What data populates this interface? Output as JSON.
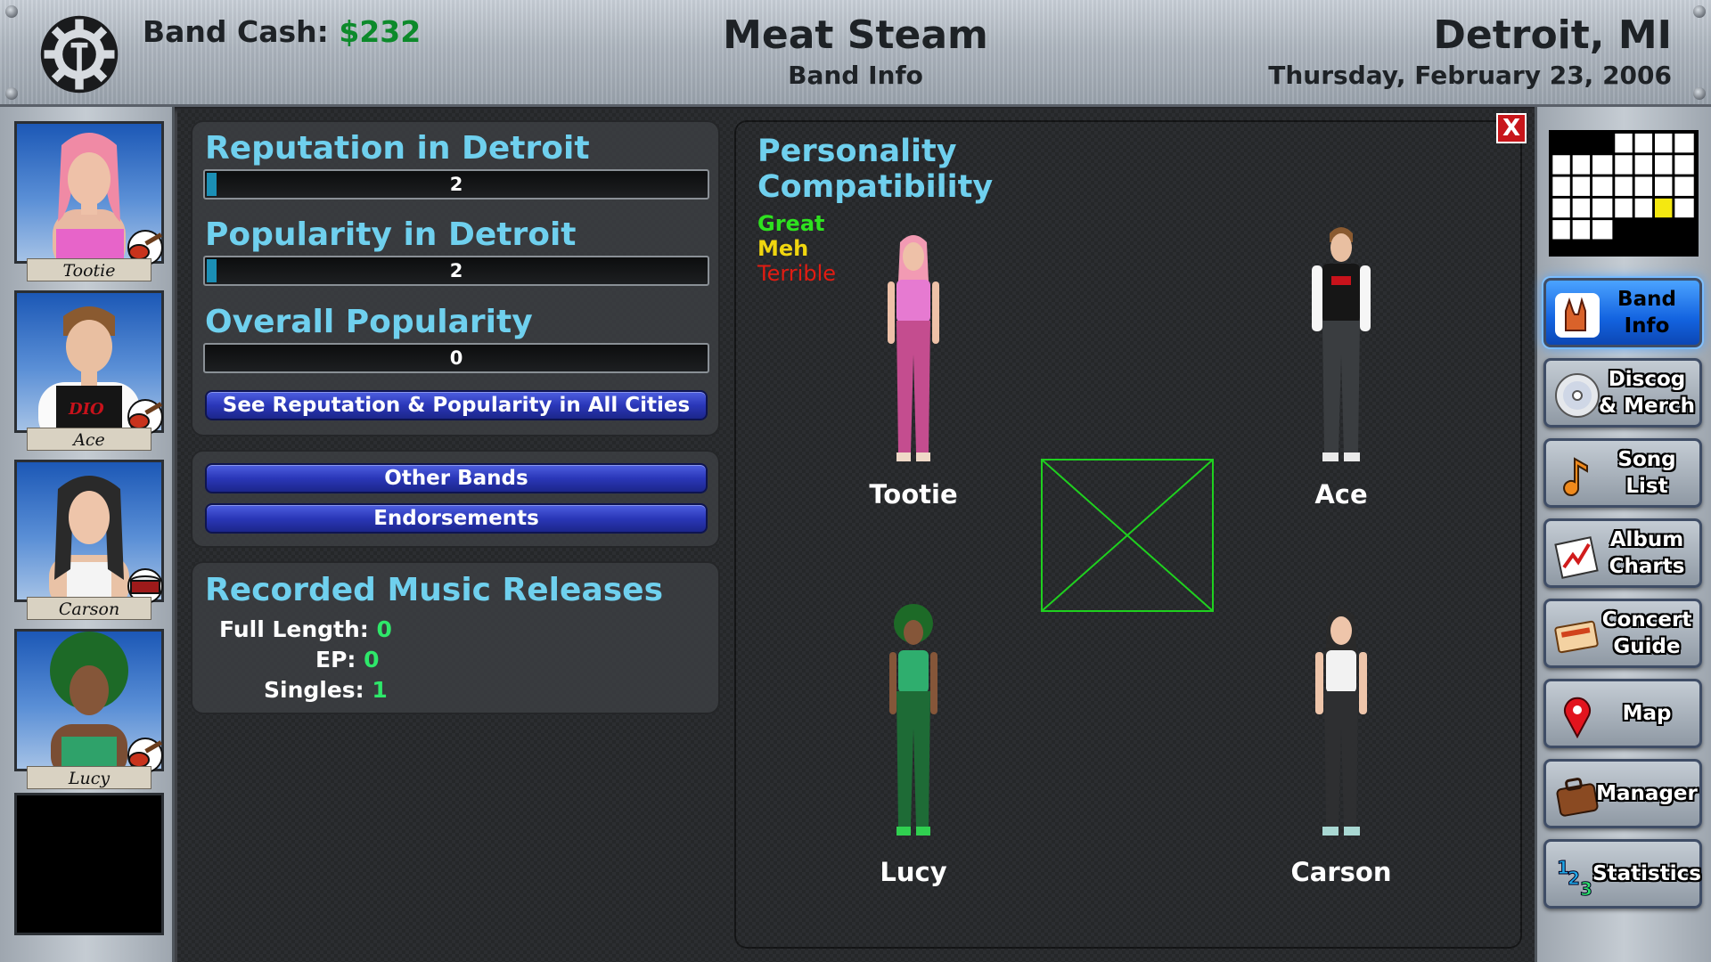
{
  "header": {
    "cash_label": "Band Cash: ",
    "cash_value": "$232",
    "band_name": "Meat Steam",
    "screen_name": "Band Info",
    "city": "Detroit, MI",
    "date": "Thursday, February 23, 2006"
  },
  "members": [
    {
      "name": "Tootie",
      "instrument": "guitar-icon",
      "color": "#d8579b"
    },
    {
      "name": "Ace",
      "instrument": "guitar-icon",
      "color": "#1a1a1a"
    },
    {
      "name": "Carson",
      "instrument": "drum-icon",
      "color": "#2b2b2b"
    },
    {
      "name": "Lucy",
      "instrument": "guitar-icon",
      "color": "#1f7d46"
    }
  ],
  "reputation": {
    "rep_title": "Reputation in Detroit",
    "rep_value": "2",
    "rep_fraction": 0.02,
    "pop_title": "Popularity in Detroit",
    "pop_value": "2",
    "pop_fraction": 0.02,
    "overall_title": "Overall Popularity",
    "overall_value": "0",
    "overall_fraction": 0,
    "all_cities_button": "See Reputation & Popularity in All Cities"
  },
  "actions": {
    "other_bands": "Other Bands",
    "endorsements": "Endorsements"
  },
  "releases": {
    "title": "Recorded Music Releases",
    "full_length_label": "Full Length:",
    "full_length_value": "0",
    "ep_label": "EP:",
    "ep_value": "0",
    "singles_label": "Singles:",
    "singles_value": "1"
  },
  "compatibility": {
    "title_line1": "Personality",
    "title_line2": "Compatibility",
    "legend_great": "Great",
    "legend_meh": "Meh",
    "legend_terrible": "Terrible",
    "legend_great_color": "#2ee21f",
    "legend_meh_color": "#f0d60f",
    "legend_terrible_color": "#e11c12",
    "top_left": "Tootie",
    "top_right": "Ace",
    "bottom_left": "Lucy",
    "bottom_right": "Carson",
    "link_color": "#1fd11f"
  },
  "close_label": "X",
  "nav": [
    {
      "label": "Band Info",
      "icon": "rock-hand-icon"
    },
    {
      "label": "Discog & Merch",
      "icon": "cd-icon"
    },
    {
      "label": "Song List",
      "icon": "music-note-icon"
    },
    {
      "label": "Album Charts",
      "icon": "chart-icon"
    },
    {
      "label": "Concert Guide",
      "icon": "ticket-icon"
    },
    {
      "label": "Map",
      "icon": "map-pin-icon"
    },
    {
      "label": "Manager",
      "icon": "briefcase-icon"
    },
    {
      "label": "Statistics",
      "icon": "numbers-icon"
    }
  ]
}
